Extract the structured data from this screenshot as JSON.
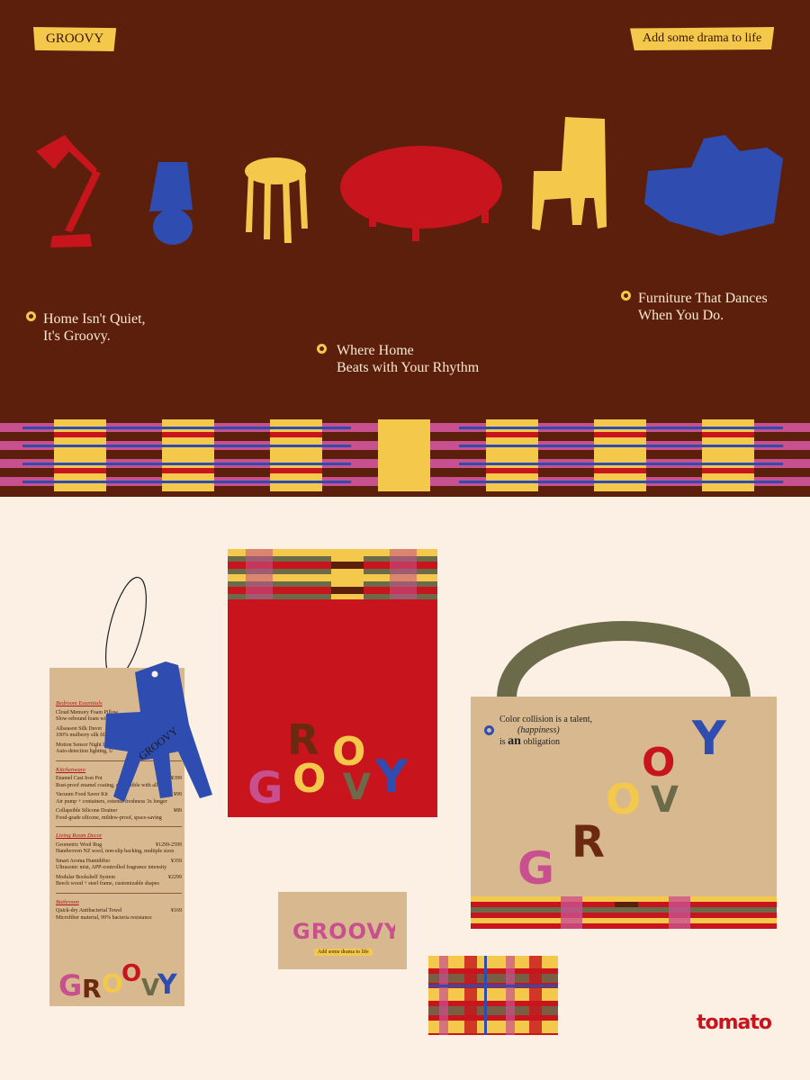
{
  "header": {
    "brand_tag": "GROOVY",
    "slogan_tag": "Add some drama to life"
  },
  "furniture_icons": [
    "desk-lamp-icon",
    "table-lamp-icon",
    "stool-icon",
    "coffee-table-icon",
    "chair-icon",
    "sofa-icon"
  ],
  "taglines": [
    {
      "line1": "Home Isn't Quiet,",
      "line2": "It's Groovy."
    },
    {
      "line1": "Where Home",
      "line2": "Beats with Your Rhythm"
    },
    {
      "line1": "Furniture That Dances",
      "line2": "When You Do."
    }
  ],
  "hang_tag": {
    "blue_tag_text": "GROOVY",
    "logo_letters": [
      "G",
      "R",
      "O",
      "O",
      "V",
      "Y"
    ],
    "sections": [
      {
        "title": "Bedroom Essentials",
        "items": [
          {
            "name": "Cloud Memory Foam Pillow",
            "price": "",
            "desc": "Slow-rebound foam with washable"
          },
          {
            "name": "Allseason Silk Duvet",
            "price": "",
            "desc": "100% mulberry silk filling, temperature"
          },
          {
            "name": "Motion Sensor Night Light",
            "price": "",
            "desc": "Auto-detection lighting, U"
          }
        ]
      },
      {
        "title": "Kitchenware",
        "items": [
          {
            "name": "Enamel Cast Iron Pot",
            "price": "¥399",
            "desc": "Rust-proof enamel coating, compatible with all"
          },
          {
            "name": "Vacuum Food Saver Kit",
            "price": "¥99",
            "desc": "Air pump + containers, extends freshness 3x longer"
          },
          {
            "name": "Collapsible Silicone Drainer",
            "price": "¥89",
            "desc": "Food-grade silicone, mildew-proof, space-saving"
          }
        ]
      },
      {
        "title": "Living Room Decor",
        "items": [
          {
            "name": "Geometric Wool Rug",
            "price": "¥1299-2599",
            "desc": "Handwoven NZ wool, non-slip backing, multiple sizes"
          },
          {
            "name": "Smart Aroma Humidifier",
            "price": "¥359",
            "desc": "Ultrasonic mist, APP-controlled fragrance intensity"
          },
          {
            "name": "Modular Bookshelf System",
            "price": "¥2299",
            "desc": "Beech wood + steel frame, customizable shapes"
          }
        ]
      },
      {
        "title": "Bathroom",
        "items": [
          {
            "name": "Quick-dry Antibacterial Towel",
            "price": "¥169",
            "desc": "Microfiber material, 99% bacteria resistance"
          }
        ]
      }
    ]
  },
  "envelope": {
    "logo_letters": [
      "R",
      "O",
      "G",
      "O",
      "V",
      "Y"
    ]
  },
  "business_card": {
    "logo": "GROOVY",
    "tagline": "Add some drama to life"
  },
  "tote_bag": {
    "copy_line1": "Color collision is a talent,",
    "copy_line2": "(happiness)",
    "copy_line3_prefix": "is",
    "copy_line3_em": "an",
    "copy_line3_suffix": "obligation",
    "logo_letters": [
      "G",
      "R",
      "O",
      "O",
      "V",
      "Y"
    ]
  },
  "footer": {
    "brand_logo": "tomato"
  },
  "colors": {
    "brown": "#5c1f0c",
    "mustard": "#f3c84b",
    "red": "#c8141c",
    "blue": "#2f4db0",
    "pink": "#c9508f",
    "olive": "#6b6b4a",
    "cream": "#fcefe4",
    "kraft": "#d8b98f"
  }
}
